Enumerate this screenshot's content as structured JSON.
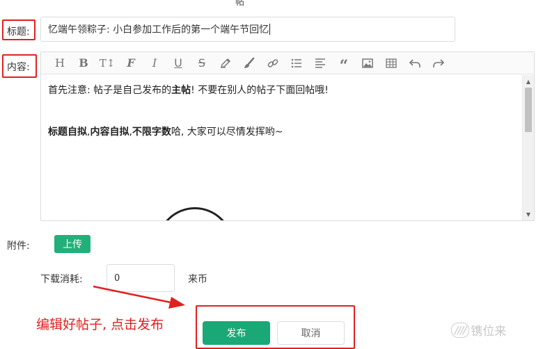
{
  "header": {
    "fragment": "帖"
  },
  "form": {
    "title_label": "标题:",
    "title_value": "忆端午领粽子: 小白参加工作后的第一个端午节回忆",
    "content_label": "内容:",
    "attachment_label": "附件:",
    "upload_label": "上传",
    "cost_label": "下载消耗:",
    "cost_value": "0",
    "cost_unit": "来币",
    "publish_label": "发布",
    "cancel_label": "取消"
  },
  "editor": {
    "toolbar": [
      {
        "name": "heading-icon",
        "glyph": "H"
      },
      {
        "name": "bold-icon",
        "glyph": "B"
      },
      {
        "name": "font-size-icon",
        "glyph": "T↕"
      },
      {
        "name": "font-family-icon",
        "glyph": "F"
      },
      {
        "name": "italic-icon",
        "glyph": "I"
      },
      {
        "name": "underline-icon",
        "glyph": "U"
      },
      {
        "name": "strikethrough-icon",
        "glyph": "S"
      },
      {
        "name": "pen-icon",
        "glyph": "pen"
      },
      {
        "name": "brush-icon",
        "glyph": "brush"
      },
      {
        "name": "link-icon",
        "glyph": "link"
      },
      {
        "name": "list-icon",
        "glyph": "list"
      },
      {
        "name": "align-icon",
        "glyph": "align"
      },
      {
        "name": "quote-icon",
        "glyph": "quote"
      },
      {
        "name": "image-icon",
        "glyph": "image"
      },
      {
        "name": "table-icon",
        "glyph": "table"
      },
      {
        "name": "undo-icon",
        "glyph": "undo"
      },
      {
        "name": "redo-icon",
        "glyph": "redo"
      }
    ],
    "line1_a": "首先注意: 帖子是自己发布的",
    "line1_bold": "主帖",
    "line1_b": "! 不要在别人的帖子下面回帖哦!",
    "line2_bold1": "标题自拟",
    "line2_sep1": ",",
    "line2_bold2": "内容自拟",
    "line2_sep2": ",",
    "line2_bold3": "不限字数",
    "line2_rest": "哈, 大家可以尽情发挥哟~"
  },
  "annotation": {
    "text": "编辑好帖子, 点击发布"
  },
  "watermark": {
    "mark": "////",
    "text": "镌位来"
  },
  "colors": {
    "accent_green": "#1aa876",
    "annotation_red": "#e02020"
  }
}
